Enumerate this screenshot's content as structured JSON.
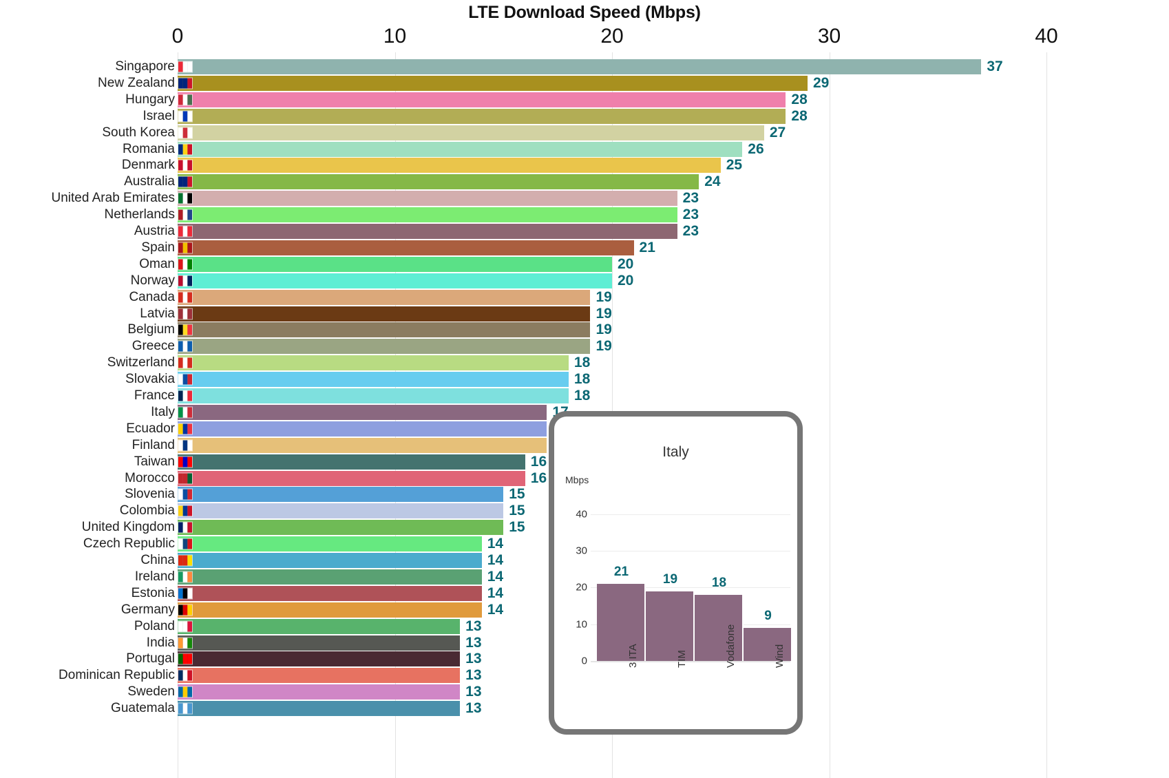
{
  "chart_data": {
    "type": "bar",
    "orientation": "horizontal",
    "title": "LTE Download Speed (Mbps)",
    "xlabel": "",
    "ylabel": "",
    "xlim": [
      0,
      40
    ],
    "xticks": [
      0,
      10,
      20,
      30,
      40
    ],
    "grid": true,
    "legend": "none",
    "value_label_color": "#0b6773",
    "categories": [
      "Singapore",
      "New Zealand",
      "Hungary",
      "Israel",
      "South Korea",
      "Romania",
      "Denmark",
      "Australia",
      "United Arab Emirates",
      "Netherlands",
      "Austria",
      "Spain",
      "Oman",
      "Norway",
      "Canada",
      "Latvia",
      "Belgium",
      "Greece",
      "Switzerland",
      "Slovakia",
      "France",
      "Italy",
      "Ecuador",
      "Finland",
      "Taiwan",
      "Morocco",
      "Slovenia",
      "Colombia",
      "United Kingdom",
      "Czech Republic",
      "China",
      "Ireland",
      "Estonia",
      "Germany",
      "Poland",
      "India",
      "Portugal",
      "Dominican Republic",
      "Sweden",
      "Guatemala"
    ],
    "values": [
      37,
      29,
      28,
      28,
      27,
      26,
      25,
      24,
      23,
      23,
      23,
      21,
      20,
      20,
      19,
      19,
      19,
      19,
      18,
      18,
      18,
      17,
      17,
      17,
      16,
      16,
      15,
      15,
      15,
      14,
      14,
      14,
      14,
      14,
      13,
      13,
      13,
      13,
      13,
      13
    ],
    "bar_colors": [
      "#8fb3ae",
      "#a8901f",
      "#ef7fab",
      "#b2ad55",
      "#d2d2a2",
      "#9fdfc0",
      "#eac54b",
      "#85b847",
      "#d3aeae",
      "#7cec72",
      "#8d6772",
      "#aa5e3f",
      "#5ae187",
      "#5eeed4",
      "#dba87a",
      "#6b3a14",
      "#8b7c60",
      "#9aa583",
      "#b8db82",
      "#67cdef",
      "#7ee0de",
      "#8a6880",
      "#8e9fdf",
      "#e6c079",
      "#44736f",
      "#e06477",
      "#54a0d7",
      "#bcc8e4",
      "#6fbb56",
      "#66e980",
      "#4babcd",
      "#5aa173",
      "#af5258",
      "#e09a3c",
      "#58b36c",
      "#565853",
      "#4a2a33",
      "#e77261",
      "#d086c6",
      "#4a90ab"
    ],
    "flag_colors": [
      [
        "#ed2939",
        "#ffffff",
        "#ffffff"
      ],
      [
        "#00247d",
        "#00247d",
        "#cc142b"
      ],
      [
        "#ce2939",
        "#ffffff",
        "#477050"
      ],
      [
        "#ffffff",
        "#0038b8",
        "#ffffff"
      ],
      [
        "#ffffff",
        "#cd2e3a",
        "#ffffff"
      ],
      [
        "#002b7f",
        "#fcd116",
        "#ce1126"
      ],
      [
        "#c8102e",
        "#ffffff",
        "#c8102e"
      ],
      [
        "#00247d",
        "#00247d",
        "#cc142b"
      ],
      [
        "#00732f",
        "#ffffff",
        "#000000"
      ],
      [
        "#ae1c28",
        "#ffffff",
        "#21468b"
      ],
      [
        "#ed2939",
        "#ffffff",
        "#ed2939"
      ],
      [
        "#aa151b",
        "#f1bf00",
        "#aa151b"
      ],
      [
        "#db161b",
        "#ffffff",
        "#008000"
      ],
      [
        "#ba0c2f",
        "#ffffff",
        "#00205b"
      ],
      [
        "#d52b1e",
        "#ffffff",
        "#d52b1e"
      ],
      [
        "#9e3039",
        "#ffffff",
        "#9e3039"
      ],
      [
        "#000000",
        "#fdda24",
        "#ef3340"
      ],
      [
        "#0d5eaf",
        "#ffffff",
        "#0d5eaf"
      ],
      [
        "#d52b1e",
        "#ffffff",
        "#d52b1e"
      ],
      [
        "#ffffff",
        "#0b4ea2",
        "#d22630"
      ],
      [
        "#002654",
        "#ffffff",
        "#ed2939"
      ],
      [
        "#009246",
        "#ffffff",
        "#ce2b37"
      ],
      [
        "#ffd100",
        "#0033a0",
        "#ef3340"
      ],
      [
        "#ffffff",
        "#003580",
        "#ffffff"
      ],
      [
        "#fe0000",
        "#0000c8",
        "#fe0000"
      ],
      [
        "#c1272d",
        "#c1272d",
        "#006233"
      ],
      [
        "#ffffff",
        "#0b4ea2",
        "#d22630"
      ],
      [
        "#fcd116",
        "#003893",
        "#ce1126"
      ],
      [
        "#012169",
        "#ffffff",
        "#c8102e"
      ],
      [
        "#ffffff",
        "#11457e",
        "#d7141a"
      ],
      [
        "#de2910",
        "#de2910",
        "#ffde00"
      ],
      [
        "#169b62",
        "#ffffff",
        "#ff883e"
      ],
      [
        "#0072ce",
        "#000000",
        "#ffffff"
      ],
      [
        "#000000",
        "#dd0000",
        "#ffce00"
      ],
      [
        "#ffffff",
        "#ffffff",
        "#dc143c"
      ],
      [
        "#ff9933",
        "#ffffff",
        "#138808"
      ],
      [
        "#006600",
        "#ff0000",
        "#ff0000"
      ],
      [
        "#002d62",
        "#ffffff",
        "#ce1126"
      ],
      [
        "#006aa7",
        "#fecc00",
        "#006aa7"
      ],
      [
        "#4997d0",
        "#ffffff",
        "#4997d0"
      ]
    ]
  },
  "inset": {
    "title": "Italy",
    "unit_label": "Mbps",
    "yticks": [
      0,
      10,
      20,
      30,
      40
    ],
    "ylim": [
      0,
      46
    ],
    "chart_data": {
      "type": "bar",
      "title": "Italy",
      "ylabel": "Mbps",
      "categories": [
        "3 ITA",
        "TIM",
        "Vodafone",
        "Wind"
      ],
      "values": [
        21,
        19,
        18,
        9
      ],
      "bar_color": "#8a6880",
      "ylim": [
        0,
        46
      ],
      "yticks": [
        0,
        10,
        20,
        30,
        40
      ]
    }
  }
}
